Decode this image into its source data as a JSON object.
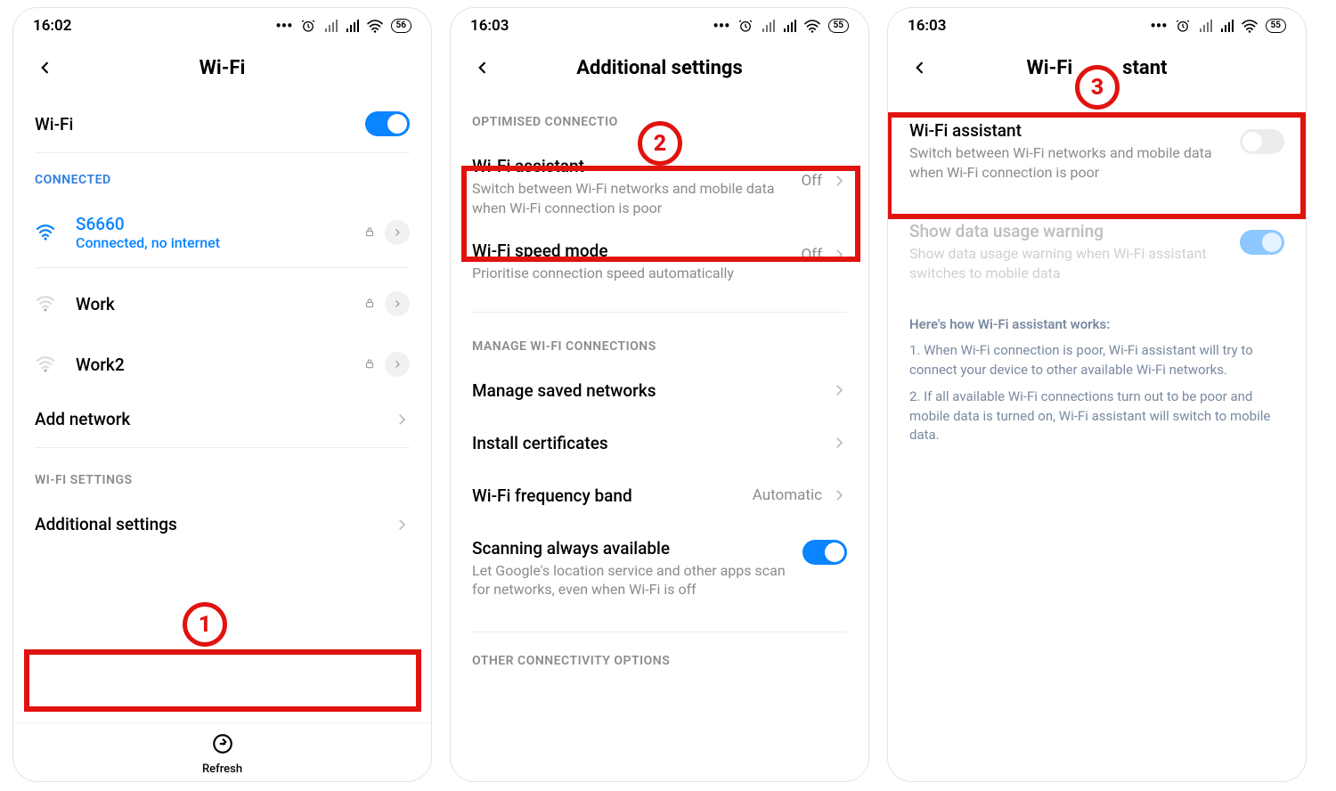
{
  "screens": {
    "s1": {
      "statusbar": {
        "time": "16:02",
        "battery": "56"
      },
      "title": "Wi-Fi",
      "wifi_toggle_label": "Wi-Fi",
      "section_connected": "CONNECTED",
      "networks": [
        {
          "name": "S6660",
          "sub": "Connected, no internet"
        },
        {
          "name": "Work"
        },
        {
          "name": "Work2"
        }
      ],
      "add_network": "Add network",
      "section_wifi_settings": "WI-FI SETTINGS",
      "additional_settings": "Additional settings",
      "refresh": "Refresh"
    },
    "s2": {
      "statusbar": {
        "time": "16:03",
        "battery": "55"
      },
      "title": "Additional settings",
      "section_optimised": "OPTIMISED CONNECTIO",
      "wifi_assistant": {
        "title": "Wi-Fi assistant",
        "sub": "Switch between Wi-Fi networks and mobile data when Wi-Fi connection is poor",
        "value": "Off"
      },
      "wifi_speed": {
        "title": "Wi-Fi speed mode",
        "sub": "Prioritise connection speed automatically",
        "value": "Off"
      },
      "section_manage": "MANAGE WI-FI CONNECTIONS",
      "manage_saved": "Manage saved networks",
      "install_cert": "Install certificates",
      "freq": {
        "title": "Wi-Fi frequency band",
        "value": "Automatic"
      },
      "scanning": {
        "title": "Scanning always available",
        "sub": "Let Google's location service and other apps scan for networks, even when Wi-Fi is off"
      },
      "section_other": "OTHER CONNECTIVITY OPTIONS"
    },
    "s3": {
      "statusbar": {
        "time": "16:03",
        "battery": "55"
      },
      "title_pre": "Wi-Fi",
      "title_post": "stant",
      "wifi_assistant": {
        "title": "Wi-Fi assistant",
        "sub": "Switch between Wi-Fi networks and mobile data when Wi-Fi connection is poor"
      },
      "data_warning": {
        "title": "Show data usage warning",
        "sub": "Show data usage warning when Wi-Fi assistant switches to mobile data"
      },
      "info_head": "Here's how Wi-Fi assistant works:",
      "info_1": "1. When Wi-Fi connection is poor, Wi-Fi assistant will try to connect your device to other available Wi-Fi networks.",
      "info_2": "2. If all available Wi-Fi connections turn out to be poor and mobile data is turned on, Wi-Fi assistant will switch to mobile data."
    }
  },
  "badges": {
    "b1": "1",
    "b2": "2",
    "b3": "3"
  }
}
